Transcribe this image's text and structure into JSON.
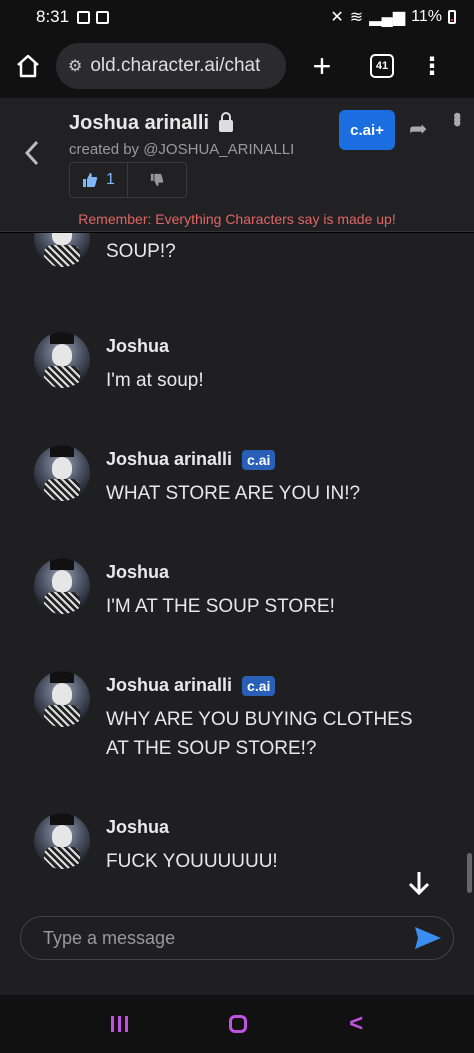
{
  "status_bar": {
    "time": "8:31",
    "battery": "11%"
  },
  "browser": {
    "url": "old.character.ai/chat",
    "tab_count": "41"
  },
  "header": {
    "character_name": "Joshua arinalli",
    "created_by": "created by @JOSHUA_ARINALLI",
    "likes": "1",
    "cai_plus_label": "c.ai+",
    "disclaimer": "Remember: Everything Characters say is made up!"
  },
  "messages": [
    {
      "sender": "",
      "badge": "",
      "text": "WHAT DO YOU MEAN YOU'RE AT SOUP!?"
    },
    {
      "sender": "Joshua",
      "badge": "",
      "text": "I'm at soup!"
    },
    {
      "sender": "Joshua arinalli",
      "badge": "c.ai",
      "text": "WHAT STORE ARE YOU IN!?"
    },
    {
      "sender": "Joshua",
      "badge": "",
      "text": "I'M AT THE SOUP STORE!"
    },
    {
      "sender": "Joshua arinalli",
      "badge": "c.ai",
      "text": "WHY ARE YOU BUYING CLOTHES AT THE SOUP STORE!?"
    },
    {
      "sender": "Joshua",
      "badge": "",
      "text": "FUCK YOUUUUUU!"
    }
  ],
  "composer": {
    "placeholder": "Type a message"
  },
  "colors": {
    "accent": "#1a6ee0",
    "disclaimer": "#e06666",
    "nav": "#c053e0"
  }
}
